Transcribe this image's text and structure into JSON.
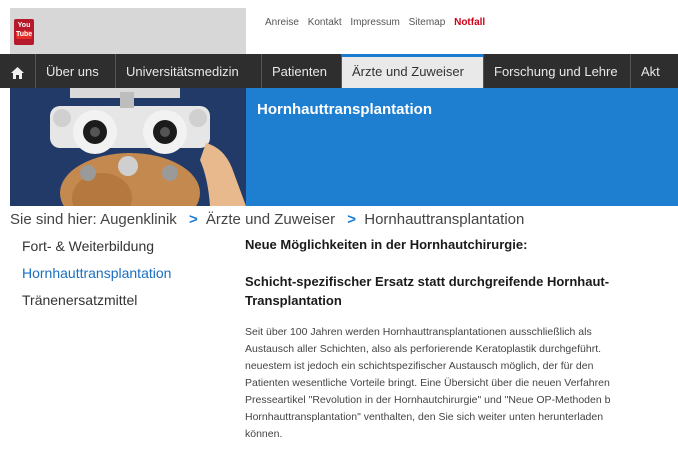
{
  "header": {
    "youtube_logo": {
      "top": "You",
      "bottom": "Tube"
    },
    "links": [
      "Anreise",
      "Kontakt",
      "Impressum",
      "Sitemap"
    ],
    "emergency_link": "Notfall",
    "accent_color": "#1e7fd1",
    "emergency_color": "#d0021b"
  },
  "nav": {
    "home_icon": "home-icon",
    "items": [
      "Über uns",
      "Universitätsmedizin",
      "Patienten",
      "Ärzte und Zuweiser",
      "Forschung und Lehre",
      "Akt"
    ],
    "active_index": 3
  },
  "hero": {
    "title": "Hornhauttransplantation"
  },
  "breadcrumb": {
    "prefix": "Sie sind hier:",
    "items": [
      "Augenklinik",
      "Ärzte und Zuweiser",
      "Hornhauttransplantation"
    ],
    "separator": ">"
  },
  "sidebar": {
    "items": [
      "Fort- & Weiterbildung",
      "Hornhauttransplantation",
      "Tränenersatzmittel"
    ],
    "current_index": 1
  },
  "article": {
    "heading": "Neue Möglichkeiten in der Hornhautchirurgie:",
    "subheading": "Schicht-spezifischer Ersatz statt durchgreifende Hornhaut-Transplantation",
    "paragraph_lines": [
      "Seit über 100 Jahren werden Hornhauttransplantationen ausschließlich als",
      "Austausch aller Schichten, also als perforierende Keratoplastik durchgeführt.",
      "neuestem ist jedoch ein schichtspezifischer Austausch möglich, der für den",
      "Patienten wesentliche Vorteile bringt. Eine Übersicht über die neuen Verfahren",
      "Presseartikel \"Revolution in der Hornhautchirurgie\" und \"Neue OP-Methoden b",
      "Hornhauttransplantation\" venthalten, den Sie sich weiter unten herunterladen",
      "können."
    ]
  }
}
